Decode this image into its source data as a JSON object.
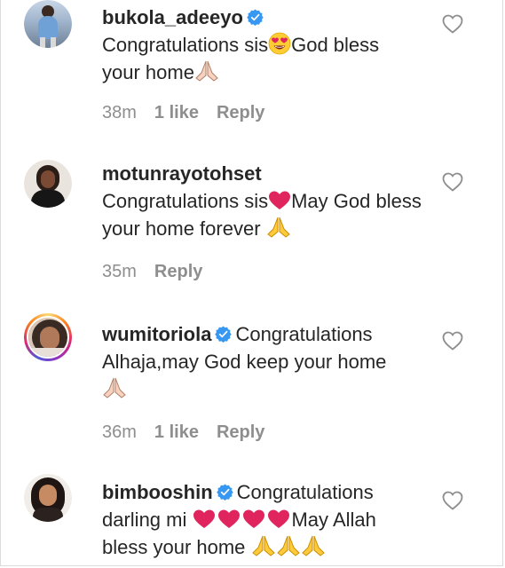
{
  "comments": [
    {
      "username": "bukola_adeeyo",
      "verified": true,
      "text_parts": [
        "Congratulations sis",
        "God bless your home"
      ],
      "time": "38m",
      "likes": "1 like",
      "reply": "Reply",
      "avatar_icon": "profile-photo"
    },
    {
      "username": "motunrayotohset",
      "verified": false,
      "text_parts": [
        "Congratulations sis",
        "May God bless your home forever "
      ],
      "time": "35m",
      "likes": "",
      "reply": "Reply",
      "avatar_icon": "profile-photo"
    },
    {
      "username": "wumitoriola",
      "verified": true,
      "text_parts": [
        "Congratulations Alhaja,may God keep your home"
      ],
      "time": "36m",
      "likes": "1 like",
      "reply": "Reply",
      "avatar_icon": "profile-photo-story-ring"
    },
    {
      "username": "bimbooshin",
      "verified": true,
      "text_parts": [
        "Congratulations darling mi ",
        "May Allah bless your home "
      ],
      "time": "",
      "likes": "",
      "reply": "",
      "avatar_icon": "profile-photo"
    }
  ],
  "colors": {
    "text": "#262626",
    "meta": "#8e8e8e",
    "verified": "#3897f0",
    "heart_outline": "#8e8e8e",
    "red_heart": "#e0245e"
  },
  "icons": {
    "heart": "heart-outline-icon",
    "verified": "verified-badge-icon",
    "pray": "folded-hands-emoji",
    "heart_eyes": "heart-eyes-emoji",
    "red_heart": "red-heart-emoji"
  }
}
